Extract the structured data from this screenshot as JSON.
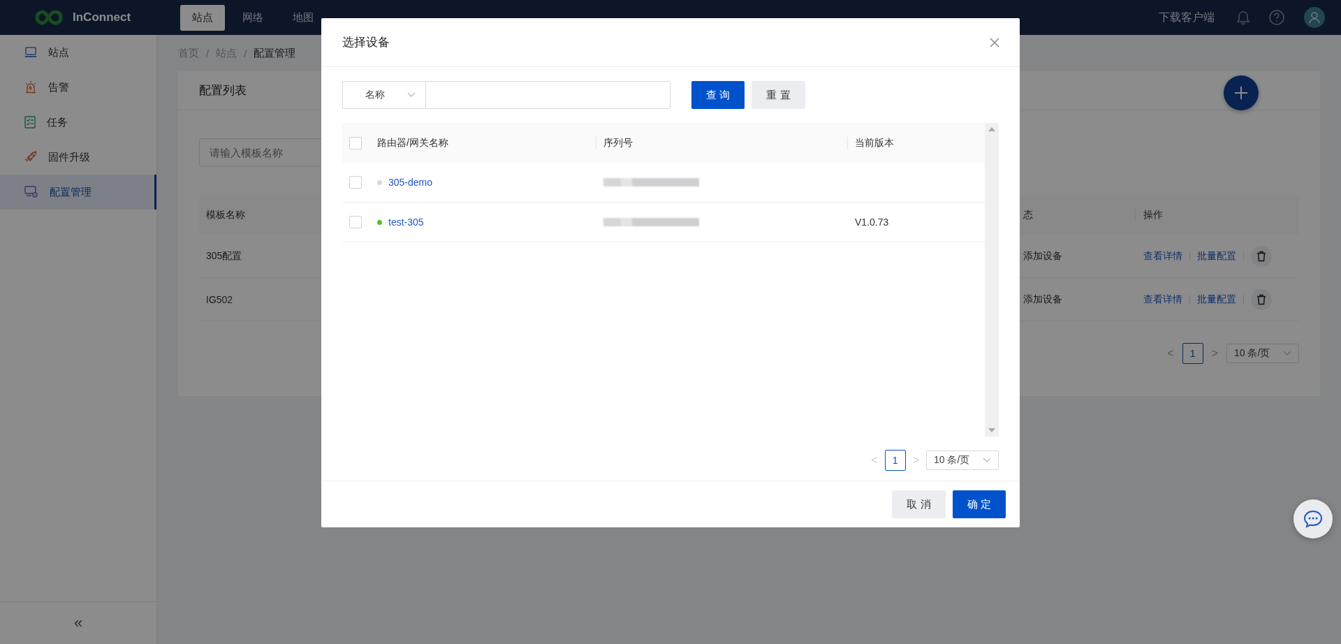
{
  "topbar": {
    "logo": "InConnect",
    "nav": [
      {
        "label": "站点",
        "selected": true
      },
      {
        "label": "网络",
        "selected": false
      },
      {
        "label": "地图",
        "selected": false
      }
    ],
    "download": "下载客户端"
  },
  "sidebar": {
    "items": [
      {
        "label": "站点",
        "kind": "monitor",
        "selected": false
      },
      {
        "label": "告警",
        "kind": "alarm",
        "selected": false
      },
      {
        "label": "任务",
        "kind": "tasks",
        "selected": false
      },
      {
        "label": "固件升级",
        "kind": "rocket",
        "selected": false
      },
      {
        "label": "配置管理",
        "kind": "config",
        "selected": true
      }
    ],
    "collapse": "«"
  },
  "breadcrumb": {
    "items": [
      "首页",
      "站点",
      "配置管理"
    ],
    "separator": "/"
  },
  "card": {
    "title": "配置列表",
    "search": {
      "placeholder": "请输入模板名称"
    },
    "table": {
      "columns": [
        "模板名称",
        "态",
        "操作"
      ],
      "rows": [
        {
          "name": "305配置",
          "status": "添加设备",
          "actions": [
            "查看详情",
            "批量配置"
          ]
        },
        {
          "name": "IG502",
          "status": "添加设备",
          "actions": [
            "查看详情",
            "批量配置"
          ]
        }
      ]
    },
    "pagination": {
      "prev": "<",
      "page": "1",
      "next": ">",
      "page_size": "10 条/页"
    }
  },
  "dialog": {
    "title": "选择设备",
    "filter": {
      "field": "名称"
    },
    "query": "查 询",
    "reset": "重 置",
    "table": {
      "columns": [
        "路由器/网关名称",
        "序列号",
        "当前版本"
      ],
      "all_checked": false,
      "rows": [
        {
          "name": "305-demo",
          "color": "#d9d9d9",
          "checked": false
        },
        {
          "name": "test-305",
          "color": "#52c41a",
          "checked": false,
          "version": "V1.0.73"
        }
      ]
    },
    "pagination": {
      "prev": "<",
      "page": "1",
      "next": ">",
      "page_size": "10 条/页"
    },
    "cancel": "取 消",
    "ok": "确 定"
  }
}
